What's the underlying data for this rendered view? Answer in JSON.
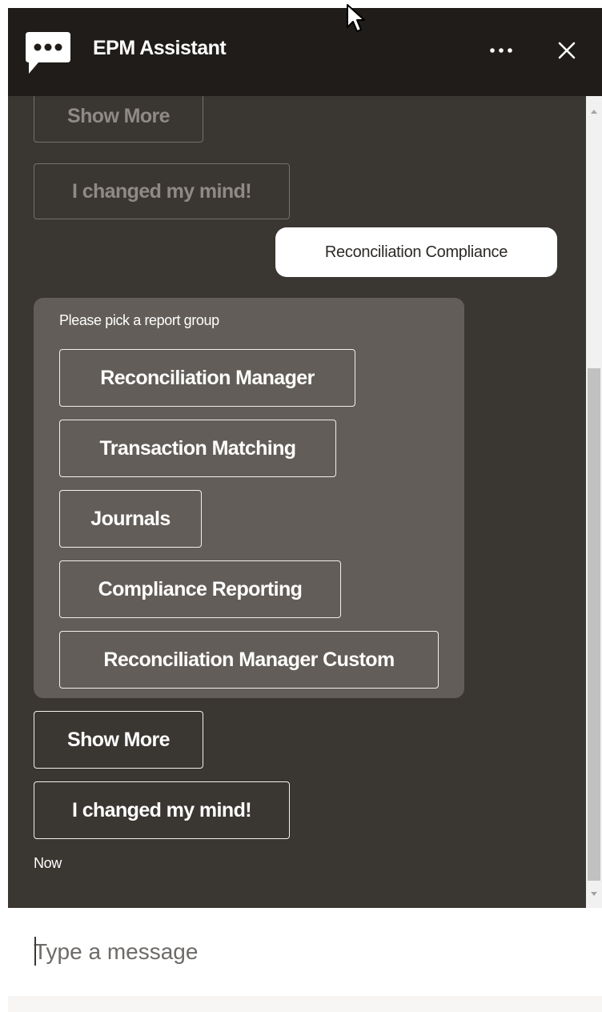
{
  "header": {
    "title": "EPM Assistant",
    "logo_icon": "chat-bubble-icon",
    "more_icon": "more-horizontal-icon",
    "close_icon": "close-icon"
  },
  "history": {
    "show_more_label": "Show More",
    "changed_mind_label": "I changed my mind!"
  },
  "user_message": "Reconciliation Compliance",
  "bot": {
    "prompt": "Please pick a report group",
    "options": [
      "Reconciliation Manager",
      "Transaction Matching",
      "Journals",
      "Compliance Reporting",
      "Reconciliation Manager Custom"
    ]
  },
  "actions": {
    "show_more_label": "Show More",
    "changed_mind_label": "I changed my mind!"
  },
  "timestamp": "Now",
  "composer": {
    "placeholder": "Type a message"
  },
  "colors": {
    "header_bg": "#1f1c19",
    "conversation_bg": "#3a3632",
    "bot_card_bg": "#625d58",
    "user_bubble_bg": "#ffffff"
  }
}
